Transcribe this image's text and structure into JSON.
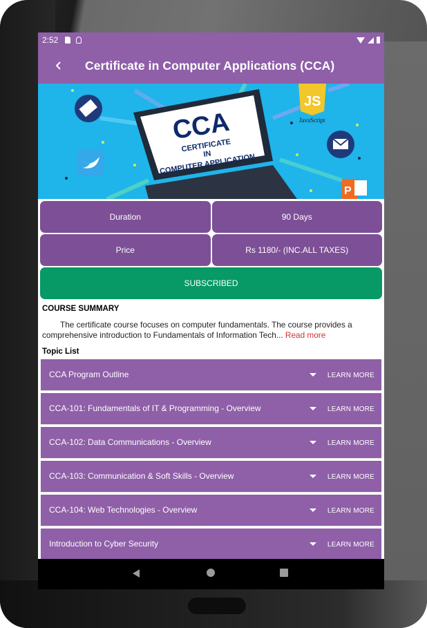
{
  "status_bar": {
    "time": "2:52",
    "icons": [
      "sd-card-icon",
      "debug-icon",
      "wifi-icon",
      "signal-icon",
      "battery-icon"
    ]
  },
  "app_bar": {
    "back_icon": "chevron-left-icon",
    "title": "Certificate in Computer Applications (CCA)"
  },
  "banner": {
    "headline": "CCA",
    "line1": "CERTIFICATE",
    "line2": "IN",
    "line3": "COMPUTER APPLICATION",
    "js_label": "JavaScript",
    "js_badge": "JS",
    "ppt_badge": "P"
  },
  "info": {
    "duration_label": "Duration",
    "duration_value": "90 Days",
    "price_label": "Price",
    "price_value": "Rs 1180/- (INC.ALL TAXES)"
  },
  "subscribe_label": "SUBSCRIBED",
  "course_summary": {
    "heading": "COURSE SUMMARY",
    "text": "The certificate course focuses on computer fundamentals. The course provides a comprehensive introduction to Fundamentals of Information Tech... ",
    "read_more": "Read more"
  },
  "topic_list": {
    "heading": "Topic List",
    "items": [
      {
        "title": "CCA Program Outline",
        "action": "LEARN MORE"
      },
      {
        "title": "CCA-101: Fundamentals of IT & Programming - Overview",
        "action": "LEARN MORE"
      },
      {
        "title": "CCA-102: Data Communications - Overview",
        "action": "LEARN MORE"
      },
      {
        "title": "CCA-103: Communication & Soft Skills - Overview",
        "action": "LEARN MORE"
      },
      {
        "title": "CCA-104: Web Technologies - Overview",
        "action": "LEARN MORE"
      },
      {
        "title": "Introduction to Cyber Security",
        "action": "LEARN MORE"
      }
    ]
  },
  "colors": {
    "primary": "#8f5fa8",
    "info_cell": "#7d4f96",
    "subscribed": "#079a66",
    "read_more": "#d03030",
    "banner_bg": "#1fb4ea"
  }
}
